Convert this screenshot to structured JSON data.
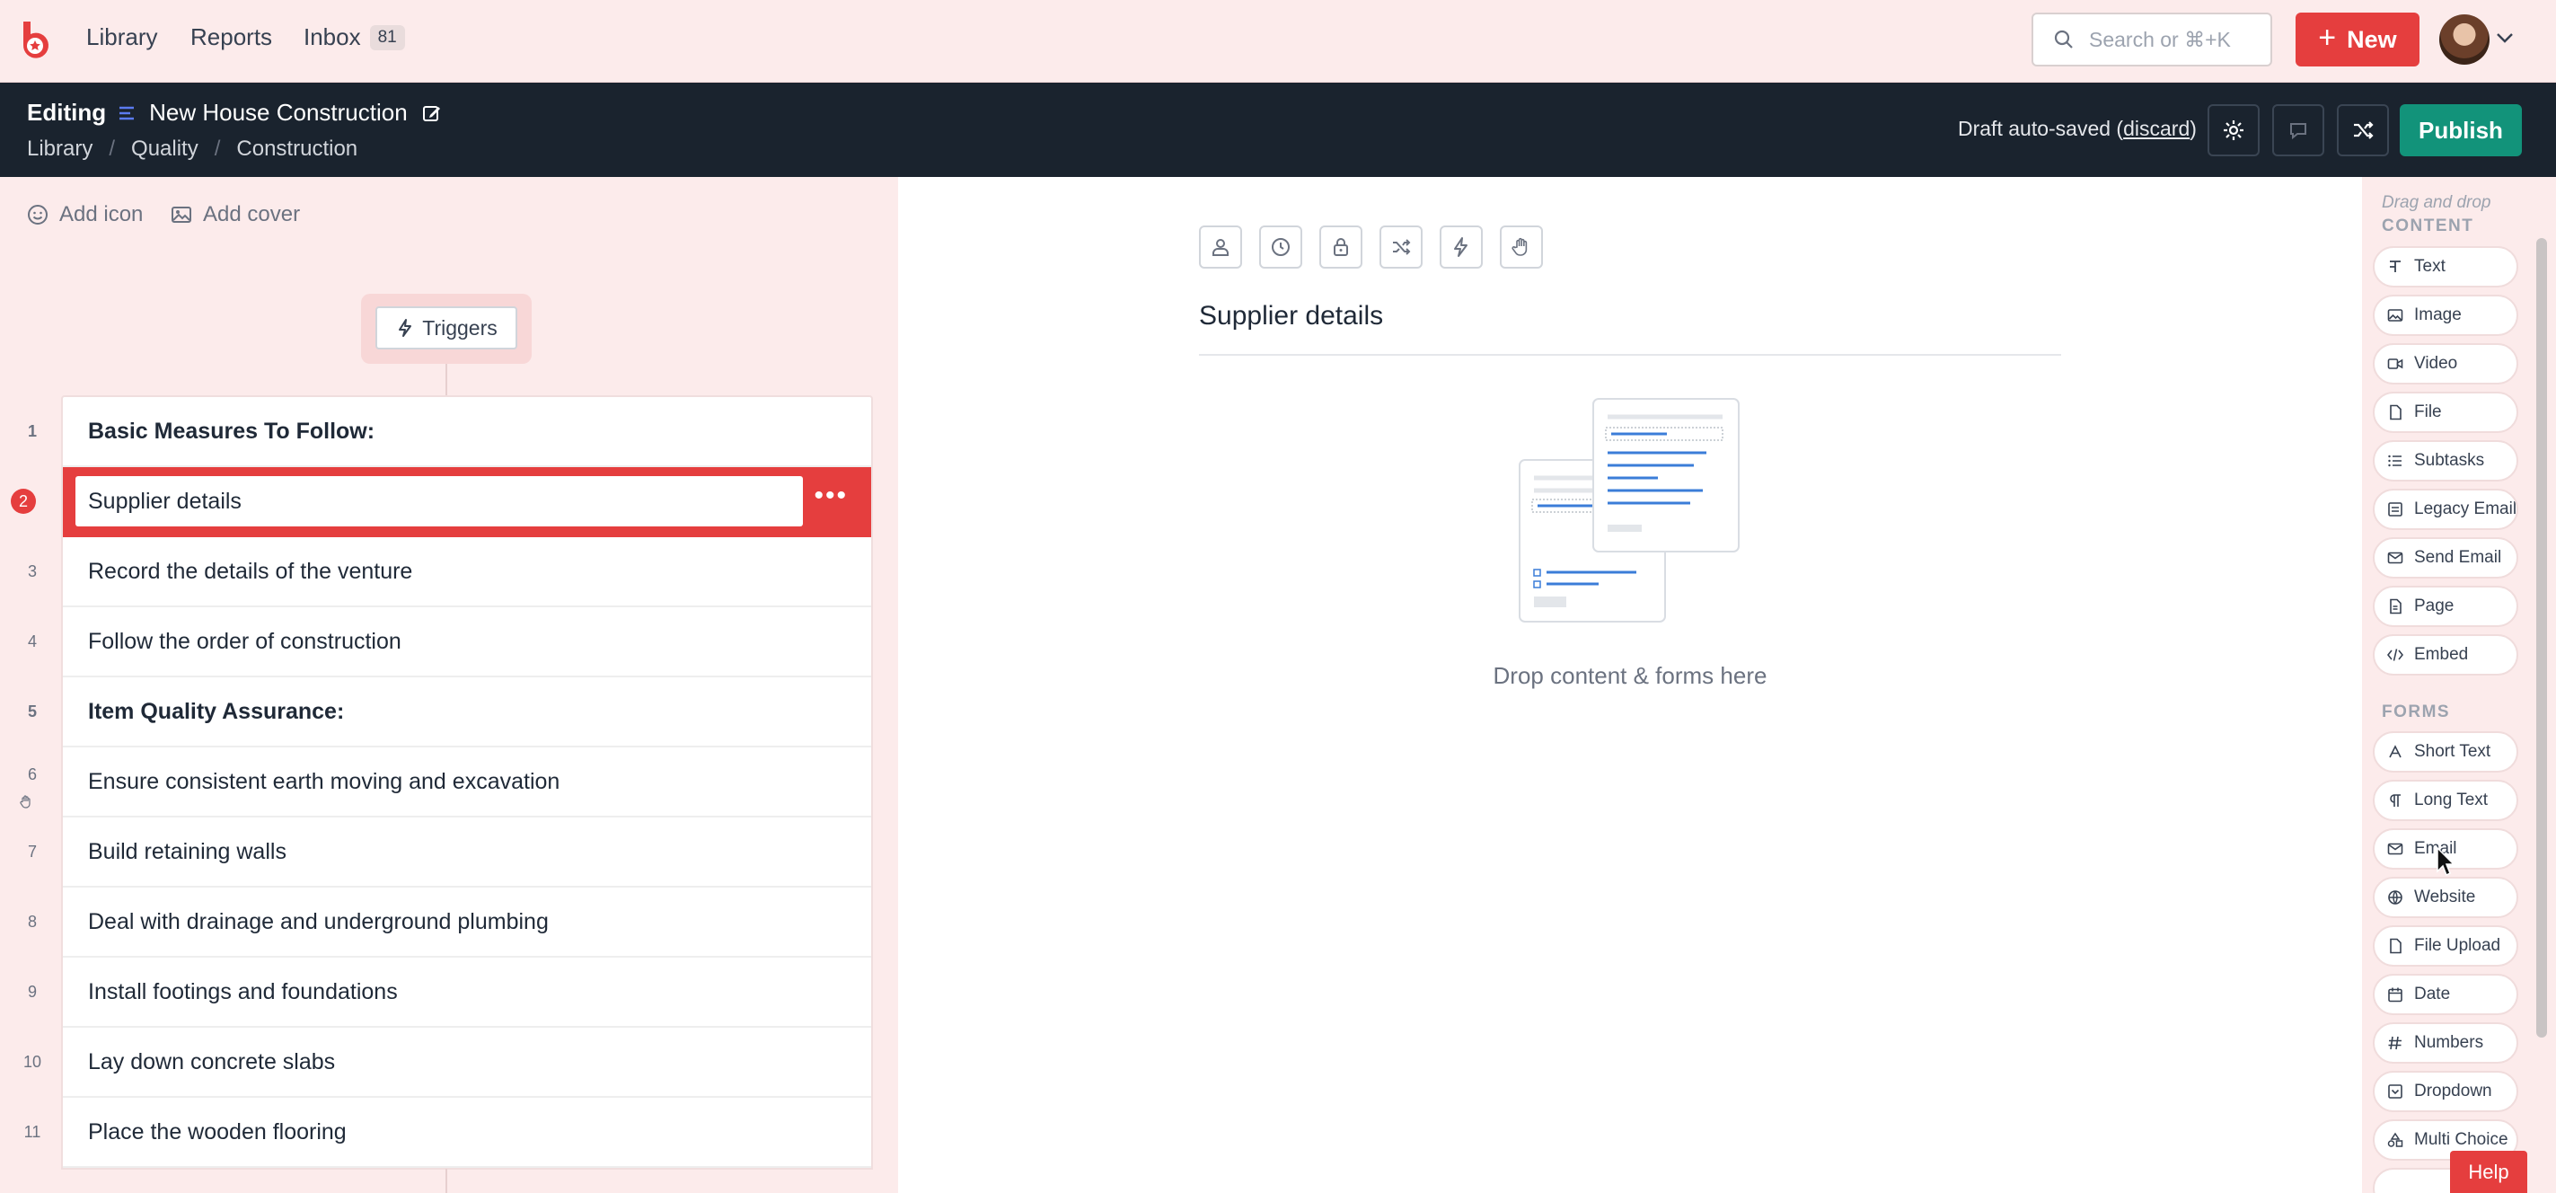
{
  "nav": {
    "links": [
      "Library",
      "Reports",
      "Inbox"
    ],
    "inbox_count": "81",
    "search_placeholder": "Search or ⌘+K",
    "new_label": "New"
  },
  "editbar": {
    "mode": "Editing",
    "title": "New House Construction",
    "breadcrumb": [
      "Library",
      "Quality",
      "Construction"
    ],
    "draft_text": "Draft auto-saved (",
    "discard_label": "discard",
    "draft_close": ")",
    "publish_label": "Publish"
  },
  "left": {
    "add_icon": "Add icon",
    "add_cover": "Add cover",
    "triggers_label": "Triggers",
    "steps": [
      {
        "num": "1",
        "label": "Basic Measures To Follow:",
        "bold": true
      },
      {
        "num": "2",
        "label": "Supplier details",
        "active": true
      },
      {
        "num": "3",
        "label": "Record the details of the venture"
      },
      {
        "num": "4",
        "label": "Follow the order of construction"
      },
      {
        "num": "5",
        "label": "Item Quality Assurance:",
        "bold": true
      },
      {
        "num": "6",
        "label": "Ensure consistent earth moving and excavation"
      },
      {
        "num": "7",
        "label": "Build retaining walls"
      },
      {
        "num": "8",
        "label": "Deal with drainage and underground plumbing"
      },
      {
        "num": "9",
        "label": "Install footings and foundations"
      },
      {
        "num": "10",
        "label": "Lay down concrete slabs"
      },
      {
        "num": "11",
        "label": "Place the wooden flooring"
      }
    ]
  },
  "center": {
    "heading": "Supplier details",
    "drop_text": "Drop content & forms here",
    "toolbar_icons": [
      "user-icon",
      "clock-icon",
      "lock-icon",
      "shuffle-icon",
      "lightning-icon",
      "hand-icon"
    ]
  },
  "right": {
    "hint": "Drag and drop",
    "content_heading": "CONTENT",
    "content_items": [
      "Text",
      "Image",
      "Video",
      "File",
      "Subtasks",
      "Legacy Email",
      "Send Email",
      "Page",
      "Embed"
    ],
    "forms_heading": "FORMS",
    "form_items": [
      "Short Text",
      "Long Text",
      "Email",
      "Website",
      "File Upload",
      "Date",
      "Numbers",
      "Dropdown",
      "Multi Choice"
    ],
    "help_label": "Help"
  },
  "colors": {
    "accent": "#e53e3e",
    "publish": "#12937a",
    "editbar": "#1a232e",
    "panel_bg": "#fcebeb"
  }
}
